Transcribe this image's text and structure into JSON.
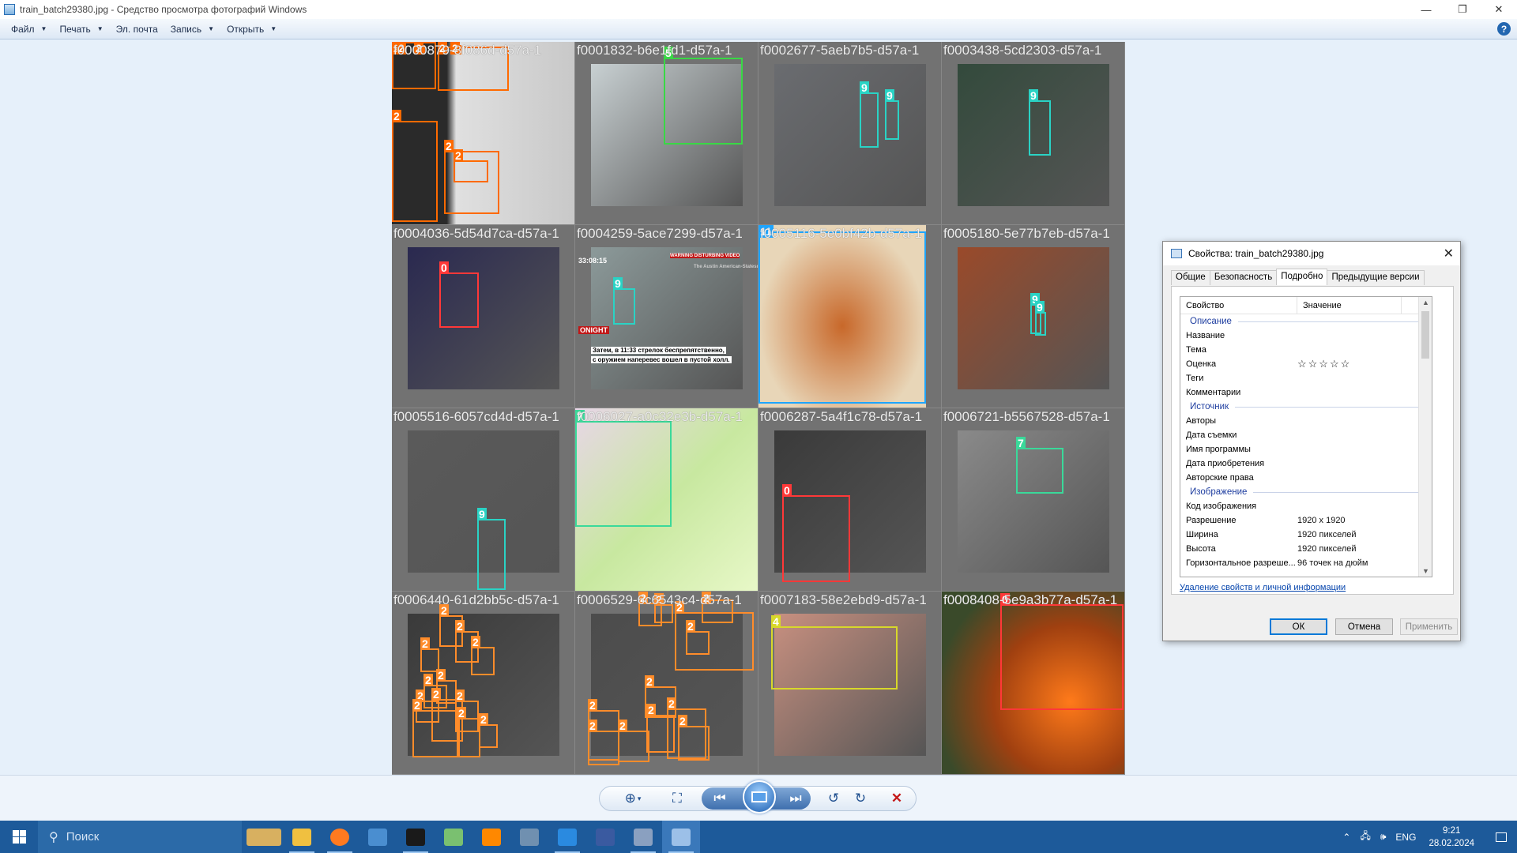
{
  "window": {
    "title": "train_batch29380.jpg - Средство просмотра фотографий Windows",
    "minimize": "—",
    "maximize": "❐",
    "close": "✕"
  },
  "menu": {
    "items": [
      {
        "label": "Файл",
        "dropdown": true
      },
      {
        "label": "Печать",
        "dropdown": true
      },
      {
        "label": "Эл. почта",
        "dropdown": false
      },
      {
        "label": "Запись",
        "dropdown": true
      },
      {
        "label": "Открыть",
        "dropdown": true
      }
    ],
    "help": "?"
  },
  "mosaic": {
    "tiles": [
      {
        "name": "f0000879-8f086d-d57a-1",
        "bg": "#8e8e8e",
        "labels": [
          "2",
          "2",
          "2",
          "2",
          "2",
          "2",
          "2",
          "2"
        ],
        "colors": [
          "#ff6a00"
        ]
      },
      {
        "name": "f0001832-b6e1fd1-d57a-1",
        "bg": "#c8d0d2",
        "labels": [
          "5"
        ],
        "colors": [
          "#39d845"
        ]
      },
      {
        "name": "f0002677-5aeb7b5-d57a-1",
        "bg": "#6a6c70",
        "labels": [
          "9",
          "9"
        ],
        "colors": [
          "#2ad3c5"
        ]
      },
      {
        "name": "f0003438-5cd2303-d57a-1",
        "bg": "#334a3c",
        "labels": [
          "9"
        ],
        "colors": [
          "#2ad3c5"
        ]
      },
      {
        "name": "f0004036-5d54d7ca-d57a-1",
        "bg": "#2a2950",
        "labels": [
          "0"
        ],
        "colors": [
          "#ff3838"
        ]
      },
      {
        "name": "f0004259-5ace7299-d57a-1",
        "bg": "#8c9a9a",
        "labels": [
          "9"
        ],
        "colors": [
          "#2ad3c5"
        ],
        "overlay": [
          "33:08:15",
          "WARNING DISTURBING VIDEO",
          "The Austin American-Statesman",
          "ONIGHT",
          "Затем, в 11:33 стрелок беспрепятственно,",
          "с оружием наперевес вошел в пустой холл."
        ]
      },
      {
        "name": "f0005116-5e0bf42b-d57a-1",
        "bg": "#d4843a",
        "labels": [
          "11"
        ],
        "colors": [
          "#1ea5ff"
        ]
      },
      {
        "name": "f0005180-5e77b7eb-d57a-1",
        "bg": "#9a4a2a",
        "labels": [
          "9",
          "9"
        ],
        "colors": [
          "#2ad3c5"
        ]
      },
      {
        "name": "f0005516-6057cd4d-d57a-1",
        "bg": "#5a5a5a",
        "labels": [
          "9"
        ],
        "colors": [
          "#2ad3c5"
        ]
      },
      {
        "name": "f0006027-a0c32e3b-d57a-1",
        "bg": "#b8d888",
        "labels": [
          "7"
        ],
        "colors": [
          "#3ad99a"
        ]
      },
      {
        "name": "f0006287-5a4f1c78-d57a-1",
        "bg": "#3a3a3a",
        "labels": [
          "0"
        ],
        "colors": [
          "#ff3838"
        ]
      },
      {
        "name": "f0006721-b5567528-d57a-1",
        "bg": "#8a8a8a",
        "labels": [
          "7"
        ],
        "colors": [
          "#3ad99a"
        ]
      },
      {
        "name": "f0006440-61d2bb5c-d57a-1",
        "bg": "#3a3a3a",
        "labels": [
          "2",
          "2",
          "2",
          "2",
          "2",
          "2",
          "2",
          "2",
          "2",
          "2",
          "2",
          "2"
        ],
        "colors": [
          "#ff8c2a"
        ]
      },
      {
        "name": "f0006529-6c6543c4-d57a-1",
        "bg": "#4c4c4c",
        "labels": [
          "2",
          "2",
          "2",
          "2",
          "2",
          "2",
          "2",
          "2",
          "2",
          "2",
          "2",
          "2"
        ],
        "colors": [
          "#ff8c2a"
        ]
      },
      {
        "name": "f0007183-58e2ebd9-d57a-1",
        "bg": "#c89080",
        "labels": [
          "4"
        ],
        "colors": [
          "#d8d82a"
        ]
      },
      {
        "name": "f0008408-5e9a3b77a-d57a-1",
        "bg": "#5a4a30",
        "labels": [
          "0"
        ],
        "colors": [
          "#ff3838"
        ]
      }
    ]
  },
  "controls": {
    "zoom": "zoom-icon",
    "fit": "fit-icon",
    "prev": "previous-icon",
    "slideshow": "slideshow-icon",
    "next": "next-icon",
    "rotate_ccw": "rotate-left-icon",
    "rotate_cw": "rotate-right-icon",
    "delete": "delete-icon"
  },
  "dialog": {
    "title": "Свойства: train_batch29380.jpg",
    "tabs": [
      "Общие",
      "Безопасность",
      "Подробно",
      "Предыдущие версии"
    ],
    "active_tab": "Подробно",
    "col_property": "Свойство",
    "col_value": "Значение",
    "sections": [
      {
        "title": "Описание",
        "rows": [
          {
            "k": "Название",
            "v": ""
          },
          {
            "k": "Тема",
            "v": ""
          },
          {
            "k": "Оценка",
            "v": "☆☆☆☆☆",
            "stars": true
          },
          {
            "k": "Теги",
            "v": ""
          },
          {
            "k": "Комментарии",
            "v": ""
          }
        ]
      },
      {
        "title": "Источник",
        "rows": [
          {
            "k": "Авторы",
            "v": ""
          },
          {
            "k": "Дата съемки",
            "v": ""
          },
          {
            "k": "Имя программы",
            "v": ""
          },
          {
            "k": "Дата приобретения",
            "v": ""
          },
          {
            "k": "Авторские права",
            "v": ""
          }
        ]
      },
      {
        "title": "Изображение",
        "rows": [
          {
            "k": "Код изображения",
            "v": ""
          },
          {
            "k": "Разрешение",
            "v": "1920 x 1920"
          },
          {
            "k": "Ширина",
            "v": "1920 пикселей"
          },
          {
            "k": "Высота",
            "v": "1920 пикселей"
          },
          {
            "k": "Горизонтальное разреше...",
            "v": "96 точек на дюйм"
          }
        ]
      }
    ],
    "remove_link": "Удаление свойств и личной информации",
    "ok": "ОК",
    "cancel": "Отмена",
    "apply": "Применить"
  },
  "taskbar": {
    "search_placeholder": "Поиск",
    "apps": [
      {
        "name": "landscape-app-icon",
        "color": "#d8b060"
      },
      {
        "name": "file-explorer-icon",
        "color": "#f0c040"
      },
      {
        "name": "firefox-icon",
        "color": "#ff7a20"
      },
      {
        "name": "python-app-icon",
        "color": "#4a8ed0"
      },
      {
        "name": "terminal-icon",
        "color": "#1a1a1a"
      },
      {
        "name": "notepad-plus-icon",
        "color": "#7ac070"
      },
      {
        "name": "vlc-icon",
        "color": "#ff8800"
      },
      {
        "name": "calculator-icon",
        "color": "#7090b0"
      },
      {
        "name": "vscode-icon",
        "color": "#2a8ae0"
      },
      {
        "name": "floppy-app-icon",
        "color": "#3a5aa0"
      },
      {
        "name": "printer-app-icon",
        "color": "#8aa0c0"
      },
      {
        "name": "photo-viewer-icon",
        "color": "#9cc0e8"
      }
    ],
    "lang": "ENG",
    "time": "9:21",
    "date": "28.02.2024"
  }
}
